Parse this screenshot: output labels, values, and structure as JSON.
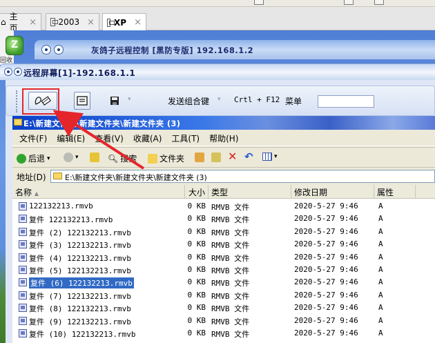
{
  "host_tabs": [
    {
      "label": "主页"
    },
    {
      "label": "2003"
    },
    {
      "label": "XP"
    }
  ],
  "desktop": {
    "icon_label": "回收站",
    "outer_title": "灰鸽子远程控制 [黑防专版]  192.168.1.2"
  },
  "remote_window": {
    "title": "远程屏幕[1]-192.168.1.1"
  },
  "toolbar": {
    "send_combo_label": "发送组合键",
    "shortcut_label": "Crtl + F12",
    "menu_label": "菜单",
    "menu_input_value": ""
  },
  "explorer": {
    "title": "E:\\新建文件夹\\新建文件夹\\新建文件夹 (3)",
    "menu": [
      "文件(F)",
      "编辑(E)",
      "查看(V)",
      "收藏(A)",
      "工具(T)",
      "帮助(H)"
    ],
    "nav": {
      "back": "后退",
      "search": "搜索",
      "folders": "文件夹"
    },
    "address_label": "地址(D)",
    "address_value": "E:\\新建文件夹\\新建文件夹\\新建文件夹 (3)",
    "columns": {
      "name": "名称",
      "size": "大小",
      "type": "类型",
      "date": "修改日期",
      "attr": "属性"
    },
    "files": [
      {
        "name": "122132213.rmvb",
        "size": "0 KB",
        "type": "RMVB 文件",
        "date": "2020-5-27 9:46",
        "attr": "A"
      },
      {
        "name": "复件 122132213.rmvb",
        "size": "0 KB",
        "type": "RMVB 文件",
        "date": "2020-5-27 9:46",
        "attr": "A"
      },
      {
        "name": "复件 (2) 122132213.rmvb",
        "size": "0 KB",
        "type": "RMVB 文件",
        "date": "2020-5-27 9:46",
        "attr": "A"
      },
      {
        "name": "复件 (3) 122132213.rmvb",
        "size": "0 KB",
        "type": "RMVB 文件",
        "date": "2020-5-27 9:46",
        "attr": "A"
      },
      {
        "name": "复件 (4) 122132213.rmvb",
        "size": "0 KB",
        "type": "RMVB 文件",
        "date": "2020-5-27 9:46",
        "attr": "A"
      },
      {
        "name": "复件 (5) 122132213.rmvb",
        "size": "0 KB",
        "type": "RMVB 文件",
        "date": "2020-5-27 9:46",
        "attr": "A"
      },
      {
        "name": "复件 (6) 122132213.rmvb",
        "size": "0 KB",
        "type": "RMVB 文件",
        "date": "2020-5-27 9:46",
        "attr": "A"
      },
      {
        "name": "复件 (7) 122132213.rmvb",
        "size": "0 KB",
        "type": "RMVB 文件",
        "date": "2020-5-27 9:46",
        "attr": "A"
      },
      {
        "name": "复件 (8) 122132213.rmvb",
        "size": "0 KB",
        "type": "RMVB 文件",
        "date": "2020-5-27 9:46",
        "attr": "A"
      },
      {
        "name": "复件 (9) 122132213.rmvb",
        "size": "0 KB",
        "type": "RMVB 文件",
        "date": "2020-5-27 9:46",
        "attr": "A"
      },
      {
        "name": "复件 (10) 122132213.rmvb",
        "size": "0 KB",
        "type": "RMVB 文件",
        "date": "2020-5-27 9:46",
        "attr": "A"
      }
    ],
    "selected_row": 6
  },
  "colors": {
    "annotation": "#e4262b",
    "selection": "#316ac5",
    "xp_title": "#0a3fc8"
  }
}
